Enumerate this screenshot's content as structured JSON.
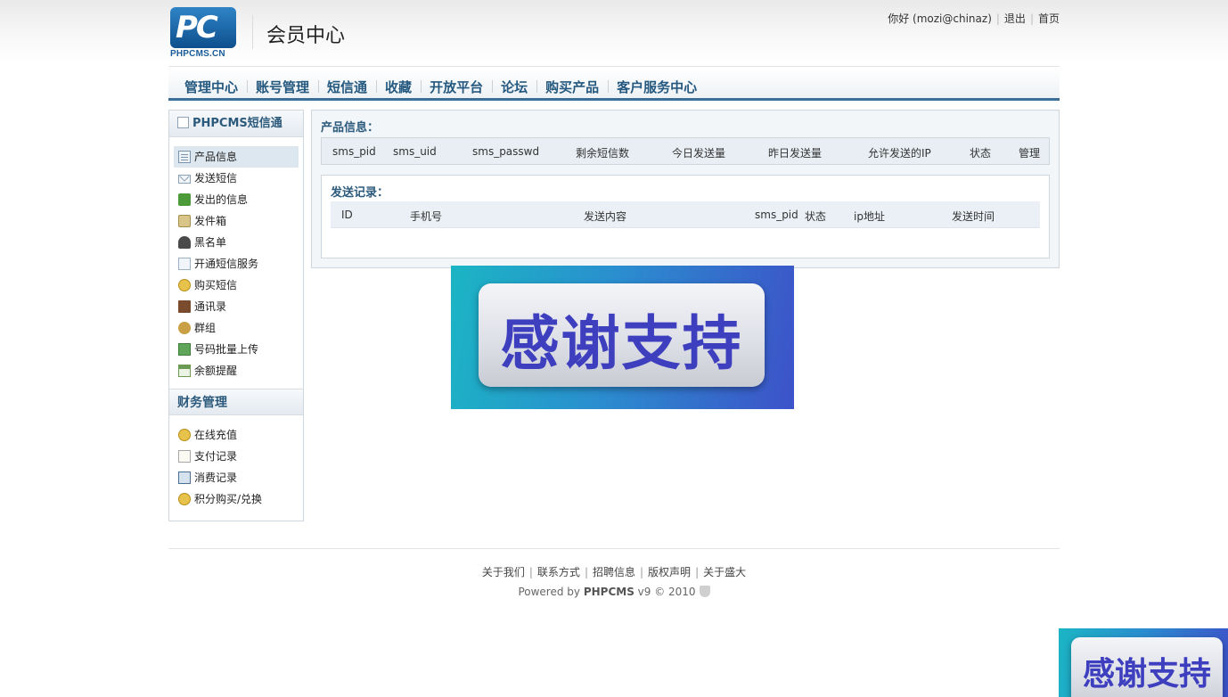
{
  "header": {
    "logo_text": "PHPCMS.CN",
    "logo_mark": "PC",
    "page_title": "会员中心",
    "greeting": "你好 (mozi@chinaz)",
    "logout": "退出",
    "home": "首页"
  },
  "nav": {
    "items": [
      "管理中心",
      "账号管理",
      "短信通",
      "收藏",
      "开放平台",
      "论坛",
      "购买产品",
      "客户服务中心"
    ]
  },
  "sidebar": {
    "section1_title": "PHPCMS短信通",
    "section1_items": [
      {
        "label": "产品信息",
        "icon": "doc-icon"
      },
      {
        "label": "发送短信",
        "icon": "mail-icon"
      },
      {
        "label": "发出的信息",
        "icon": "outbox-icon"
      },
      {
        "label": "发件箱",
        "icon": "box-icon"
      },
      {
        "label": "黑名单",
        "icon": "user-icon"
      },
      {
        "label": "开通短信服务",
        "icon": "card-icon"
      },
      {
        "label": "购买短信",
        "icon": "coins-icon"
      },
      {
        "label": "通讯录",
        "icon": "book-icon"
      },
      {
        "label": "群组",
        "icon": "group-icon"
      },
      {
        "label": "号码批量上传",
        "icon": "upload-icon"
      },
      {
        "label": "余额提醒",
        "icon": "calendar-icon"
      }
    ],
    "section2_title": "财务管理",
    "section2_items": [
      {
        "label": "在线充值",
        "icon": "coins-icon"
      },
      {
        "label": "支付记录",
        "icon": "paper-icon"
      },
      {
        "label": "消费记录",
        "icon": "calculator-icon"
      },
      {
        "label": "积分购买/兑换",
        "icon": "coins-icon"
      }
    ]
  },
  "product": {
    "title": "产品信息：",
    "columns": [
      "sms_pid",
      "sms_uid",
      "sms_passwd",
      "剩余短信数",
      "今日发送量",
      "昨日发送量",
      "允许发送的IP",
      "状态",
      "管理"
    ]
  },
  "send_log": {
    "title": "发送记录：",
    "columns": [
      "ID",
      "手机号",
      "发送内容",
      "sms_pid",
      "状态",
      "ip地址",
      "发送时间"
    ]
  },
  "banner": {
    "text": "感谢支持"
  },
  "footer": {
    "links": [
      "关于我们",
      "联系方式",
      "招聘信息",
      "版权声明",
      "关于盛大"
    ],
    "powered_prefix": "Powered by ",
    "powered_brand": "PHPCMS",
    "powered_suffix": " v9 © 2010"
  }
}
